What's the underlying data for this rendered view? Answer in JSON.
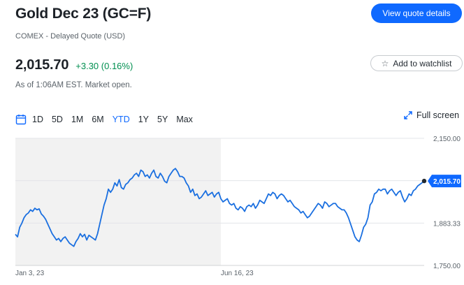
{
  "header": {
    "title": "Gold Dec 23 (GC=F)",
    "subtitle": "COMEX - Delayed Quote (USD)",
    "view_quote_label": "View quote details",
    "add_watchlist_label": "Add to watchlist"
  },
  "quote": {
    "price": "2,015.70",
    "change": "+3.30 (0.16%)",
    "as_of": "As of 1:06AM EST. Market open.",
    "change_color": "#008f50"
  },
  "range": {
    "buttons": [
      "1D",
      "5D",
      "1M",
      "6M",
      "YTD",
      "1Y",
      "5Y",
      "Max"
    ],
    "active": "YTD",
    "calendar_icon": "calendar-icon",
    "fullscreen_label": "Full screen",
    "fullscreen_icon": "expand-arrows-icon"
  },
  "colors": {
    "accent": "#0f69ff",
    "line": "#1a6fe0",
    "shade": "#f2f2f2"
  },
  "chart_data": {
    "type": "line",
    "x_tick_labels": [
      "Jan 3, 23",
      "Jun 16, 23"
    ],
    "y_tick_labels": [
      "2,150.00",
      "1,883.33",
      "1,750.00"
    ],
    "ylim": [
      1750,
      2150
    ],
    "last_value_label": "2,015.70",
    "shaded_period": "Jan 3, 23 – Jun 16, 23",
    "series": [
      {
        "values": [
          1848,
          1840,
          1870,
          1883,
          1900,
          1910,
          1915,
          1925,
          1920,
          1930,
          1925,
          1928,
          1912,
          1905,
          1895,
          1880,
          1865,
          1850,
          1840,
          1830,
          1835,
          1825,
          1835,
          1840,
          1830,
          1820,
          1815,
          1810,
          1825,
          1835,
          1850,
          1840,
          1848,
          1830,
          1845,
          1840,
          1835,
          1830,
          1850,
          1880,
          1910,
          1940,
          1960,
          1990,
          1980,
          1990,
          2010,
          2000,
          2020,
          1995,
          1990,
          2005,
          2010,
          2020,
          2025,
          2035,
          2040,
          2030,
          2050,
          2045,
          2030,
          2035,
          2025,
          2040,
          2050,
          2030,
          2025,
          2040,
          2030,
          2015,
          2010,
          2030,
          2040,
          2050,
          2055,
          2045,
          2030,
          2030,
          2025,
          2010,
          2000,
          1980,
          1990,
          1970,
          1975,
          1960,
          1965,
          1975,
          1985,
          1970,
          1975,
          1980,
          1965,
          1975,
          1980,
          1960,
          1950,
          1955,
          1960,
          1945,
          1940,
          1945,
          1930,
          1925,
          1935,
          1930,
          1920,
          1935,
          1940,
          1935,
          1945,
          1930,
          1940,
          1955,
          1950,
          1945,
          1960,
          1975,
          1970,
          1980,
          1975,
          1960,
          1970,
          1975,
          1970,
          1960,
          1950,
          1955,
          1945,
          1935,
          1930,
          1925,
          1915,
          1920,
          1910,
          1900,
          1905,
          1915,
          1925,
          1935,
          1945,
          1940,
          1930,
          1950,
          1945,
          1935,
          1940,
          1945,
          1945,
          1935,
          1930,
          1925,
          1925,
          1915,
          1900,
          1880,
          1860,
          1840,
          1830,
          1825,
          1845,
          1870,
          1880,
          1900,
          1940,
          1950,
          1975,
          1980,
          1990,
          1985,
          1990,
          1990,
          1975,
          1985,
          1990,
          1980,
          1970,
          1980,
          1985,
          1965,
          1950,
          1960,
          1975,
          1970,
          1985,
          1990,
          2000,
          2005,
          2010,
          2015.7
        ]
      }
    ]
  }
}
